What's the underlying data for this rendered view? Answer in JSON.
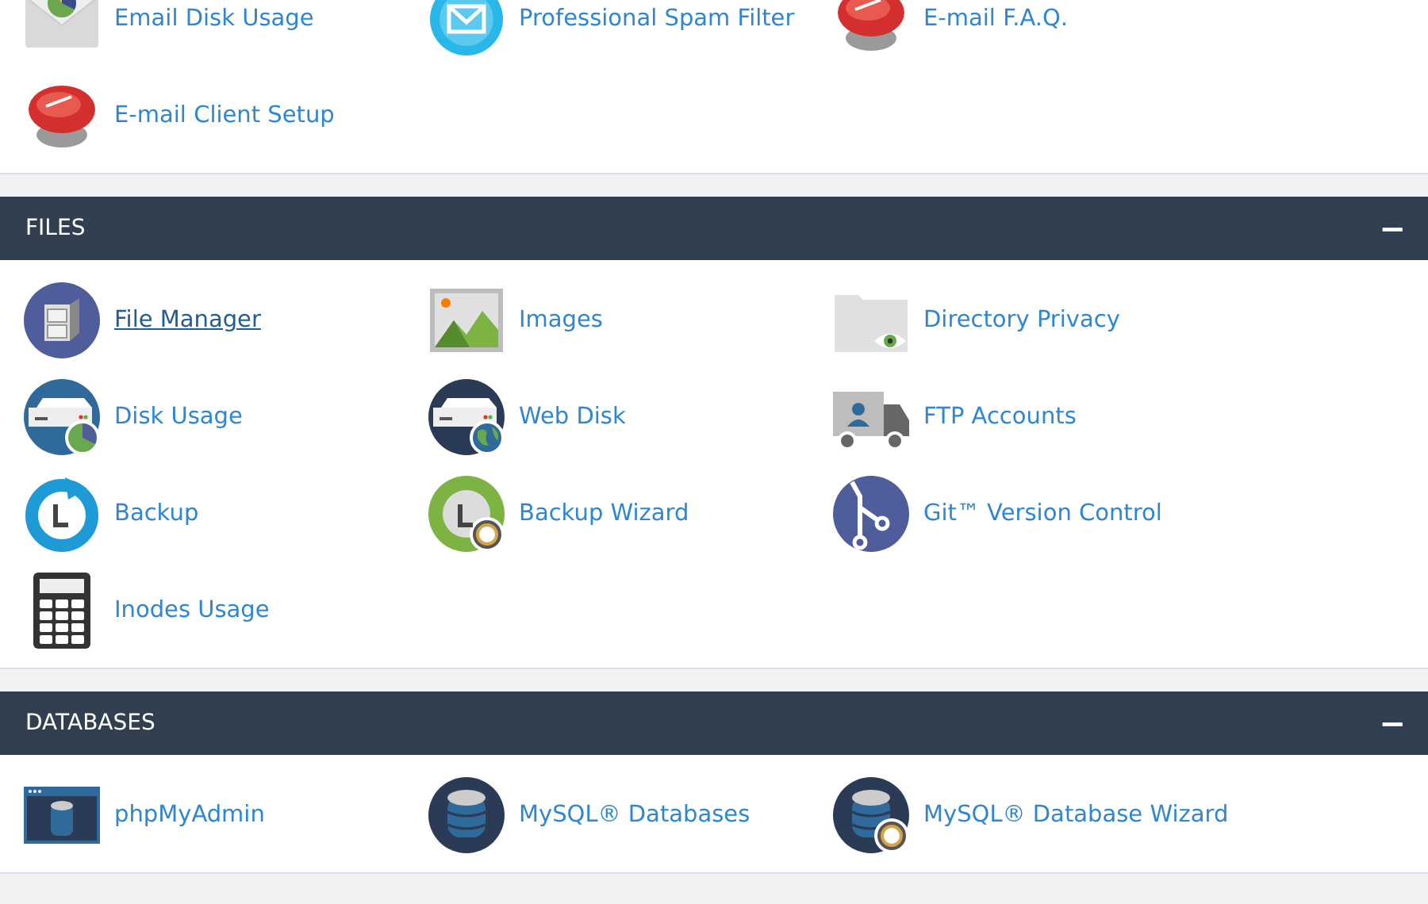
{
  "sections": [
    {
      "items": [
        {
          "label": "Email Disk Usage",
          "kind": "envelope-pie",
          "hovered": false
        },
        {
          "label": "Professional Spam Filter",
          "kind": "envelope-circle",
          "hovered": false
        },
        {
          "label": "E-mail F.A.Q.",
          "kind": "help",
          "hovered": false
        },
        {
          "label": "E-mail Client Setup",
          "kind": "help",
          "hovered": false
        }
      ]
    },
    {
      "title": "FILES",
      "collapse_symbol": "−",
      "items": [
        {
          "label": "File Manager",
          "kind": "cabinet",
          "hovered": true
        },
        {
          "label": "Images",
          "kind": "image",
          "hovered": false
        },
        {
          "label": "Directory Privacy",
          "kind": "folder-eye",
          "hovered": false
        },
        {
          "label": "Disk Usage",
          "kind": "drive-pie",
          "hovered": false
        },
        {
          "label": "Web Disk",
          "kind": "drive-globe",
          "hovered": false
        },
        {
          "label": "FTP Accounts",
          "kind": "truck",
          "hovered": false
        },
        {
          "label": "Backup",
          "kind": "backup",
          "hovered": false
        },
        {
          "label": "Backup Wizard",
          "kind": "backup-wizard",
          "hovered": false
        },
        {
          "label": "Git™ Version Control",
          "kind": "git",
          "hovered": false
        },
        {
          "label": "Inodes Usage",
          "kind": "calculator",
          "hovered": false
        }
      ]
    },
    {
      "title": "DATABASES",
      "collapse_symbol": "−",
      "items": [
        {
          "label": "phpMyAdmin",
          "kind": "db-window",
          "hovered": false
        },
        {
          "label": "MySQL® Databases",
          "kind": "db",
          "hovered": false
        },
        {
          "label": "MySQL® Database Wizard",
          "kind": "db-wizard",
          "hovered": false
        }
      ]
    }
  ]
}
